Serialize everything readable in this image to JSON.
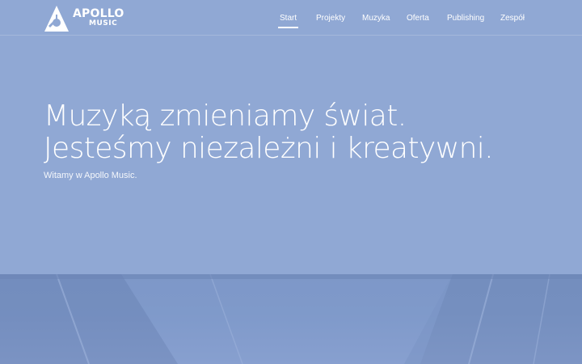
{
  "brand": {
    "name_top": "APOLLO",
    "name_bottom": "MUSIC"
  },
  "nav": {
    "items": [
      {
        "label": "Start",
        "active": true
      },
      {
        "label": "Projekty",
        "active": false
      },
      {
        "label": "Muzyka",
        "active": false
      },
      {
        "label": "Oferta",
        "active": false
      },
      {
        "label": "Publishing",
        "active": false
      },
      {
        "label": "Zespół",
        "active": false
      }
    ]
  },
  "hero": {
    "line1": "Muzyką zmieniamy świat.",
    "line2": "Jesteśmy niezależni i kreatywni.",
    "subtitle": "Witamy w Apollo Music."
  },
  "colors": {
    "background": "#90a8d4",
    "text": "#ffffff",
    "band": "#7892c2"
  }
}
